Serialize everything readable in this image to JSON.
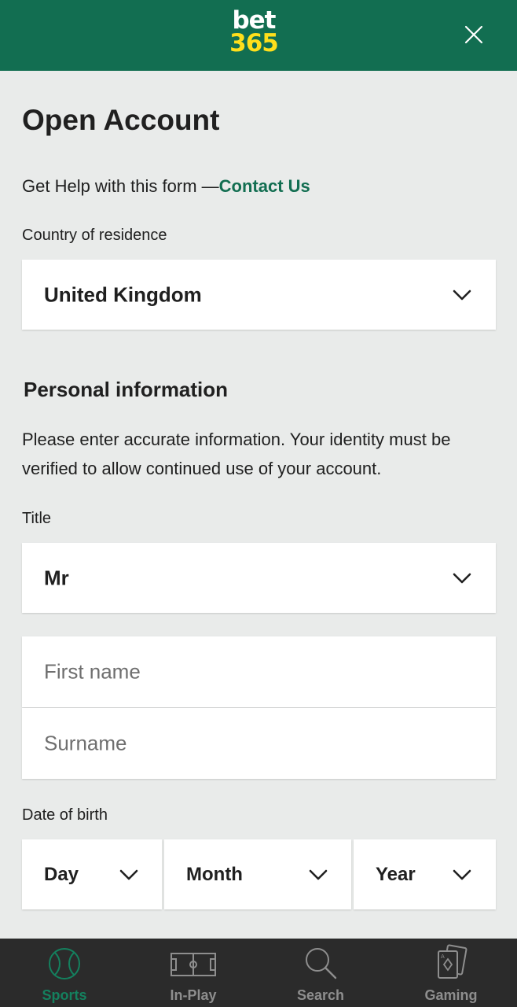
{
  "header": {
    "logo_top": "bet",
    "logo_bottom": "365",
    "close_icon": "close-icon"
  },
  "form": {
    "title": "Open Account",
    "help_text": "Get Help with this form —",
    "help_link": "Contact Us",
    "country_label": "Country of residence",
    "country_value": "United Kingdom",
    "section_title": "Personal information",
    "section_desc": "Please enter accurate information. Your identity must be verified to allow continued use of your account.",
    "title_label": "Title",
    "title_value": "Mr",
    "first_name_placeholder": "First name",
    "surname_placeholder": "Surname",
    "dob_label": "Date of birth",
    "dob_day": "Day",
    "dob_month": "Month",
    "dob_year": "Year"
  },
  "nav": {
    "items": [
      {
        "label": "Sports",
        "icon": "tennis-ball-icon",
        "active": true
      },
      {
        "label": "In-Play",
        "icon": "pitch-icon",
        "active": false
      },
      {
        "label": "Search",
        "icon": "search-icon",
        "active": false
      },
      {
        "label": "Gaming",
        "icon": "cards-icon",
        "active": false
      }
    ]
  },
  "colors": {
    "brand_green": "#126e51",
    "logo_yellow": "#ffdf1b",
    "nav_active": "#14805e",
    "nav_background": "#2b2b2b",
    "page_background": "#e9ebea"
  }
}
